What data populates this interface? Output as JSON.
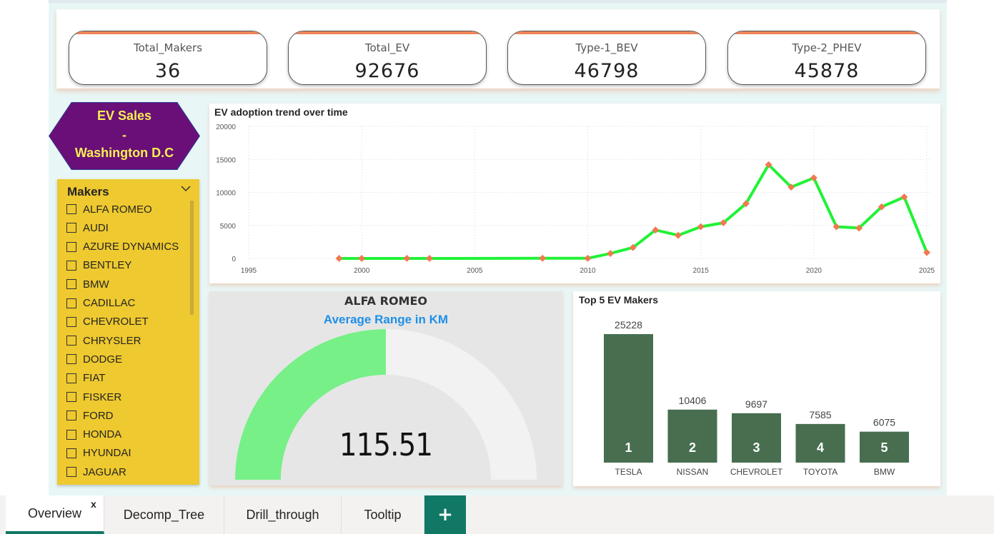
{
  "kpis": [
    {
      "label": "Total_Makers",
      "value": "36"
    },
    {
      "label": "Total_EV",
      "value": "92676"
    },
    {
      "label": "Type-1_BEV",
      "value": "46798"
    },
    {
      "label": "Type-2_PHEV",
      "value": "45878"
    }
  ],
  "title": {
    "line1": "EV Sales",
    "line2": "-",
    "line3": "Washington D.C"
  },
  "slicer": {
    "title": "Makers",
    "items": [
      "ALFA ROMEO",
      "AUDI",
      "AZURE DYNAMICS",
      "BENTLEY",
      "BMW",
      "CADILLAC",
      "CHEVROLET",
      "CHRYSLER",
      "DODGE",
      "FIAT",
      "FISKER",
      "FORD",
      "HONDA",
      "HYUNDAI",
      "JAGUAR"
    ]
  },
  "gauge": {
    "maker": "ALFA ROMEO",
    "subtitle": "Average Range in KM",
    "value_text": "115.51",
    "value": 115.51,
    "fill_fraction": 0.5
  },
  "tabs": {
    "items": [
      "Overview",
      "Decomp_Tree",
      "Drill_through",
      "Tooltip"
    ],
    "close_label": "x",
    "add_label": "+"
  },
  "colors": {
    "line": "#21f236",
    "marker": "#f07a50",
    "bar": "#486e4f",
    "gauge_fill": "#77f088",
    "gauge_track": "#f2f2f2",
    "accent": "#117865"
  },
  "chart_data": [
    {
      "type": "line",
      "title": "EV adoption trend over time",
      "xlabel": "",
      "ylabel": "",
      "xlim": [
        1995,
        2025
      ],
      "ylim": [
        0,
        20000
      ],
      "xticks": [
        1995,
        2000,
        2005,
        2010,
        2015,
        2020,
        2025
      ],
      "yticks": [
        0,
        5000,
        10000,
        15000,
        20000
      ],
      "grid": true,
      "x": [
        1999,
        2000,
        2002,
        2003,
        2008,
        2010,
        2011,
        2012,
        2013,
        2014,
        2015,
        2016,
        2017,
        2018,
        2019,
        2020,
        2021,
        2022,
        2023,
        2024,
        2025
      ],
      "y": [
        5,
        5,
        5,
        5,
        20,
        20,
        750,
        1650,
        4300,
        3500,
        4800,
        5400,
        8300,
        14200,
        10800,
        12200,
        4800,
        4600,
        7800,
        9300,
        900
      ]
    },
    {
      "type": "bar",
      "title": "Top 5 EV Makers",
      "categories": [
        "TESLA",
        "NISSAN",
        "CHEVROLET",
        "TOYOTA",
        "BMW"
      ],
      "values": [
        25228,
        10406,
        9697,
        7585,
        6075
      ],
      "ranks": [
        "1",
        "2",
        "3",
        "4",
        "5"
      ],
      "xlabel": "",
      "ylabel": ""
    }
  ]
}
